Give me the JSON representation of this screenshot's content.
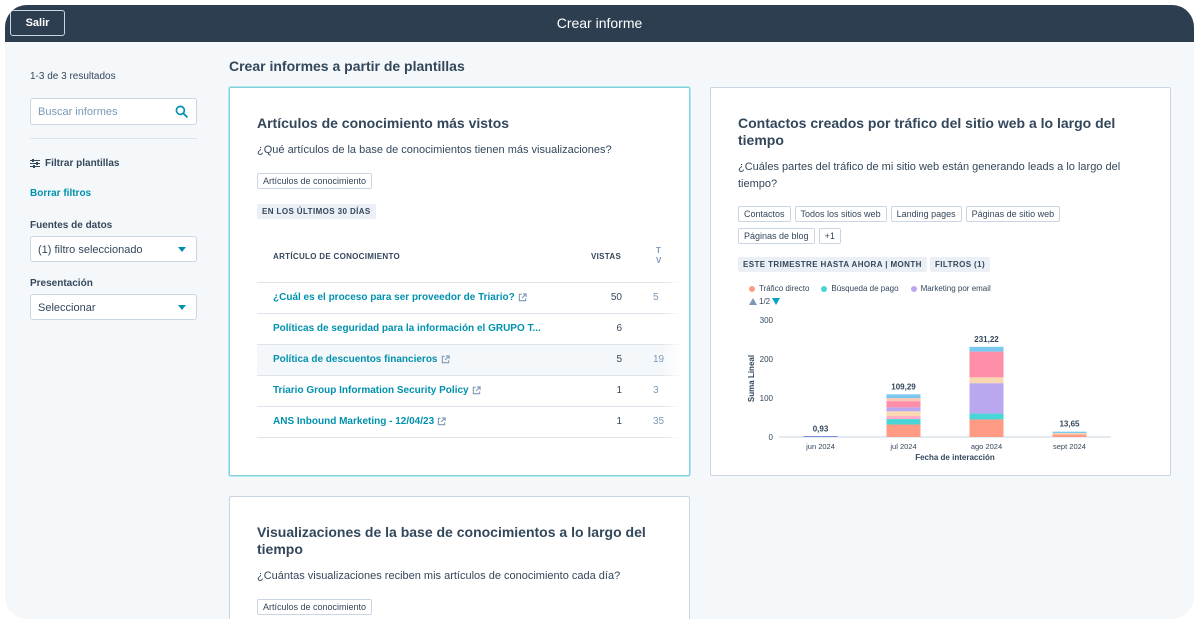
{
  "header": {
    "exit_label": "Salir",
    "title": "Crear informe"
  },
  "sidebar": {
    "results": "1-3 de 3 resultados",
    "search_placeholder": "Buscar informes",
    "filter_label": "Filtrar plantillas",
    "clear_filters": "Borrar filtros",
    "data_sources_label": "Fuentes de datos",
    "data_sources_value": "(1) filtro seleccionado",
    "presentation_label": "Presentación",
    "presentation_value": "Seleccionar"
  },
  "main": {
    "title": "Crear informes a partir de plantillas"
  },
  "card1": {
    "title": "Artículos de conocimiento más vistos",
    "desc": "¿Qué artículos de la base de conocimientos tienen más visualizaciones?",
    "tag": "Artículos de conocimiento",
    "period": "EN LOS ÚLTIMOS 30 DÍAS",
    "col1": "ARTÍCULO DE CONOCIMIENTO",
    "col2": "VISTAS",
    "col3a": "T",
    "col3b": "V",
    "rows": [
      {
        "name": "¿Cuál es el proceso para ser proveedor de Triario?",
        "views": "50",
        "extra": "5",
        "link": true
      },
      {
        "name": "Políticas de seguridad para la información el GRUPO T...",
        "views": "6",
        "extra": "",
        "link": false
      },
      {
        "name": "Política de descuentos financieros",
        "views": "5",
        "extra": "19",
        "link": true
      },
      {
        "name": "Triario Group Information Security Policy",
        "views": "1",
        "extra": "3",
        "link": true
      },
      {
        "name": "ANS Inbound Marketing - 12/04/23",
        "views": "1",
        "extra": "35",
        "link": true
      }
    ]
  },
  "card2": {
    "title_line1": "Contactos creados por tráfico del sitio web a lo largo del",
    "title_line2": "tiempo",
    "desc_line1": "¿Cuáles partes del tráfico de mi sitio web están generando leads a lo largo del",
    "desc_line2": "tiempo?",
    "tags": [
      "Contactos",
      "Todos los sitios web",
      "Landing pages",
      "Páginas de sitio web",
      "Páginas de blog",
      "+1"
    ],
    "period": "ESTE TRIMESTRE HASTA AHORA | MONTH",
    "filters": "FILTROS (1)",
    "legend": [
      {
        "name": "Tráfico directo",
        "color": "#ff9b85"
      },
      {
        "name": "Búsqueda de pago",
        "color": "#47d5d7"
      },
      {
        "name": "Marketing por email",
        "color": "#b9a7f0"
      }
    ],
    "pager": "1/2"
  },
  "card3": {
    "title_line1": "Visualizaciones de la base de conocimientos a lo largo del",
    "title_line2": "tiempo",
    "desc": "¿Cuántas visualizaciones reciben mis artículos de conocimiento cada día?",
    "tag": "Artículos de conocimiento"
  },
  "chart_data": {
    "type": "bar",
    "stacked": true,
    "categories": [
      "jun 2024",
      "jul 2024",
      "ago 2024",
      "sept 2024"
    ],
    "totals": [
      0.93,
      109.29,
      231.22,
      13.65
    ],
    "total_labels": [
      "0,93",
      "109,29",
      "231,22",
      "13,65"
    ],
    "ylabel": "Suma Lineal",
    "xlabel": "Fecha de interacción",
    "ylim": [
      0,
      300
    ],
    "yticks": [
      0,
      100,
      200,
      300
    ],
    "segments": [
      {
        "colors": [
          "#7b8fd6"
        ],
        "values": [
          0.93
        ]
      },
      {
        "colors": [
          "#ff9b85",
          "#47d5d7",
          "#ffb0c7",
          "#f8d8b0",
          "#b9a7f0",
          "#ff8fa8",
          "#f6c8b8",
          "#7ac7ef"
        ],
        "values": [
          32,
          14,
          8,
          12,
          10,
          16,
          8,
          9.29
        ]
      },
      {
        "colors": [
          "#ff9b85",
          "#47d5d7",
          "#b9a7f0",
          "#f8d8b0",
          "#ff8fa8",
          "#7ac7ef"
        ],
        "values": [
          45,
          15,
          78,
          15,
          66,
          12.22
        ]
      },
      {
        "colors": [
          "#ff9b85",
          "#f8d8b0",
          "#7ac7ef"
        ],
        "values": [
          7,
          3,
          3.65
        ]
      }
    ]
  }
}
